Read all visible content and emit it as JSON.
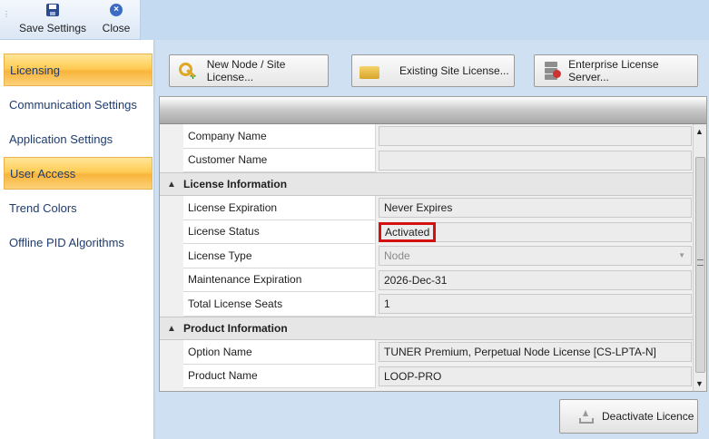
{
  "toolbar": {
    "save_label": "Save Settings",
    "close_label": "Close"
  },
  "sidebar": {
    "items": [
      {
        "label": "Licensing",
        "selected": true
      },
      {
        "label": "Communication Settings",
        "selected": false
      },
      {
        "label": "Application Settings",
        "selected": false
      },
      {
        "label": "User Access",
        "selected": true
      },
      {
        "label": "Trend Colors",
        "selected": false
      },
      {
        "label": "Offline PID Algorithms",
        "selected": false
      }
    ]
  },
  "actions": {
    "new_node": "New Node / Site License...",
    "existing_site": "Existing Site License...",
    "enterprise_server": "Enterprise License Server..."
  },
  "grid": {
    "rows_top": [
      {
        "name": "Company Name",
        "value": ""
      },
      {
        "name": "Customer Name",
        "value": ""
      }
    ],
    "license_info": {
      "label": "License Information",
      "rows": [
        {
          "name": "License Expiration",
          "value": "Never Expires"
        },
        {
          "name": "License Status",
          "value": "Activated"
        },
        {
          "name": "License Type",
          "value": "Node"
        },
        {
          "name": "Maintenance Expiration",
          "value": "2026-Dec-31"
        },
        {
          "name": "Total License Seats",
          "value": "1"
        }
      ]
    },
    "product_info": {
      "label": "Product Information",
      "rows": [
        {
          "name": "Option Name",
          "value": "TUNER Premium, Perpetual Node License [CS-LPTA-N]"
        },
        {
          "name": "Product Name",
          "value": "LOOP-PRO"
        }
      ]
    }
  },
  "deactivate_label": "Deactivate Licence",
  "colors": {
    "selected_nav": "#ffcc55",
    "highlight_border": "#d41010",
    "nav_text": "#1e3c6e"
  }
}
